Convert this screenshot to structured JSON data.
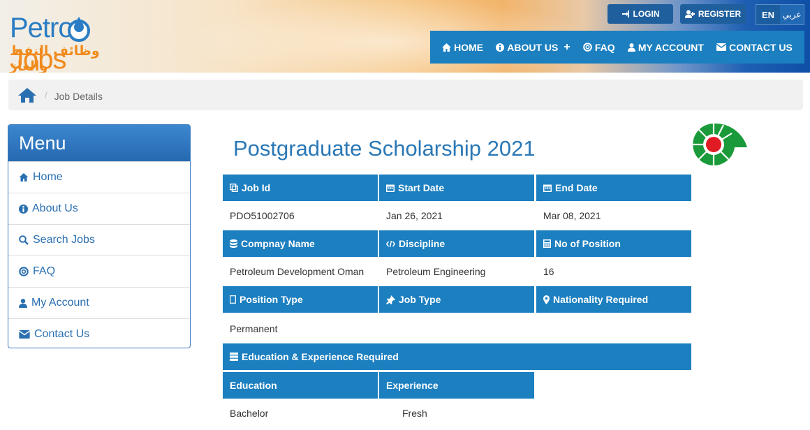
{
  "header": {
    "logo": {
      "petro": "Petro",
      "jobs": "Jobs",
      "arabic": "وظائف النفط والغاز"
    },
    "login_label": "LOGIN",
    "register_label": "REGISTER",
    "lang_en": "EN",
    "lang_ar": "عربي"
  },
  "nav": {
    "items": [
      {
        "label": "HOME",
        "icon": "home-icon"
      },
      {
        "label": "ABOUT US",
        "icon": "info-icon"
      },
      {
        "label": "FAQ",
        "icon": "lifebuoy-icon"
      },
      {
        "label": "MY ACCOUNT",
        "icon": "user-icon"
      },
      {
        "label": "CONTACT US",
        "icon": "envelope-icon"
      }
    ]
  },
  "breadcrumb": {
    "current": "Job Details"
  },
  "sidebar": {
    "title": "Menu",
    "items": [
      {
        "label": "Home",
        "icon": "home-icon"
      },
      {
        "label": "About Us",
        "icon": "info-icon"
      },
      {
        "label": "Search Jobs",
        "icon": "search-icon"
      },
      {
        "label": "FAQ",
        "icon": "lifebuoy-icon"
      },
      {
        "label": "My Account",
        "icon": "user-icon"
      },
      {
        "label": "Contact Us",
        "icon": "envelope-icon"
      }
    ]
  },
  "job": {
    "title": "Postgraduate Scholarship 2021",
    "labels": {
      "job_id": "Job Id",
      "start_date": "Start Date",
      "end_date": "End Date",
      "company": "Compnay Name",
      "discipline": "Discipline",
      "positions": "No of Position",
      "position_type": "Position Type",
      "job_type": "Job Type",
      "nationality": "Nationality Required",
      "edu_exp": "Education & Experience Required",
      "education": "Education",
      "experience": "Experience"
    },
    "values": {
      "job_id": "PDO51002706",
      "start_date": "Jan 26, 2021",
      "end_date": "Mar 08, 2021",
      "company": "Petroleum Development Oman",
      "discipline": "Petroleum Engineering",
      "positions": "16",
      "position_type": "Permanent",
      "job_type": "",
      "nationality": "",
      "education": "Bachelor",
      "experience": "Fresh"
    }
  },
  "colors": {
    "accent": "#1c7fc0",
    "link": "#2a6fb0",
    "logo_orange": "#f08a1c",
    "logo_blue": "#2a7dc4"
  }
}
